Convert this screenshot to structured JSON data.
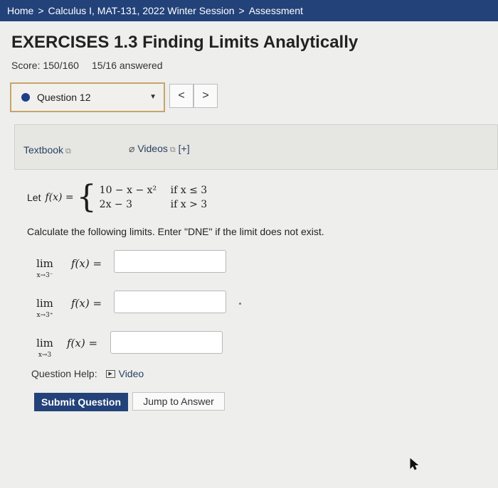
{
  "breadcrumb": {
    "home": "Home",
    "sep1": ">",
    "course": "Calculus I, MAT-131, 2022 Winter Session",
    "sep2": ">",
    "current": "Assessment"
  },
  "page": {
    "title": "EXERCISES 1.3 Finding Limits Analytically",
    "score": "Score: 150/160",
    "answered": "15/16 answered"
  },
  "question_select": {
    "label": "Question 12",
    "prev": "<",
    "next": ">"
  },
  "resources": {
    "textbook": "Textbook",
    "videos": "Videos",
    "expand": "[+]"
  },
  "problem": {
    "let": "Let",
    "fx": "f(x) =",
    "case1_expr": "10 − x − x²",
    "case1_cond": "if  x ≤ 3",
    "case2_expr": "2x − 3",
    "case2_cond": "if  x > 3",
    "instruction": "Calculate the following limits. Enter \"DNE\" if the limit does not exist."
  },
  "limits": [
    {
      "lim": "lim",
      "sub": "x→3⁻",
      "expr": "f(x) =",
      "value": ""
    },
    {
      "lim": "lim",
      "sub": "x→3⁺",
      "expr": "f(x) =",
      "value": ""
    },
    {
      "lim": "lim",
      "sub": "x→3",
      "expr": "f(x) =",
      "value": ""
    }
  ],
  "help": {
    "label": "Question Help:",
    "video": "Video"
  },
  "buttons": {
    "submit": "Submit Question",
    "jump": "Jump to Answer"
  },
  "colors": {
    "nav_blue": "#23427a",
    "select_border": "#c6a56a"
  }
}
